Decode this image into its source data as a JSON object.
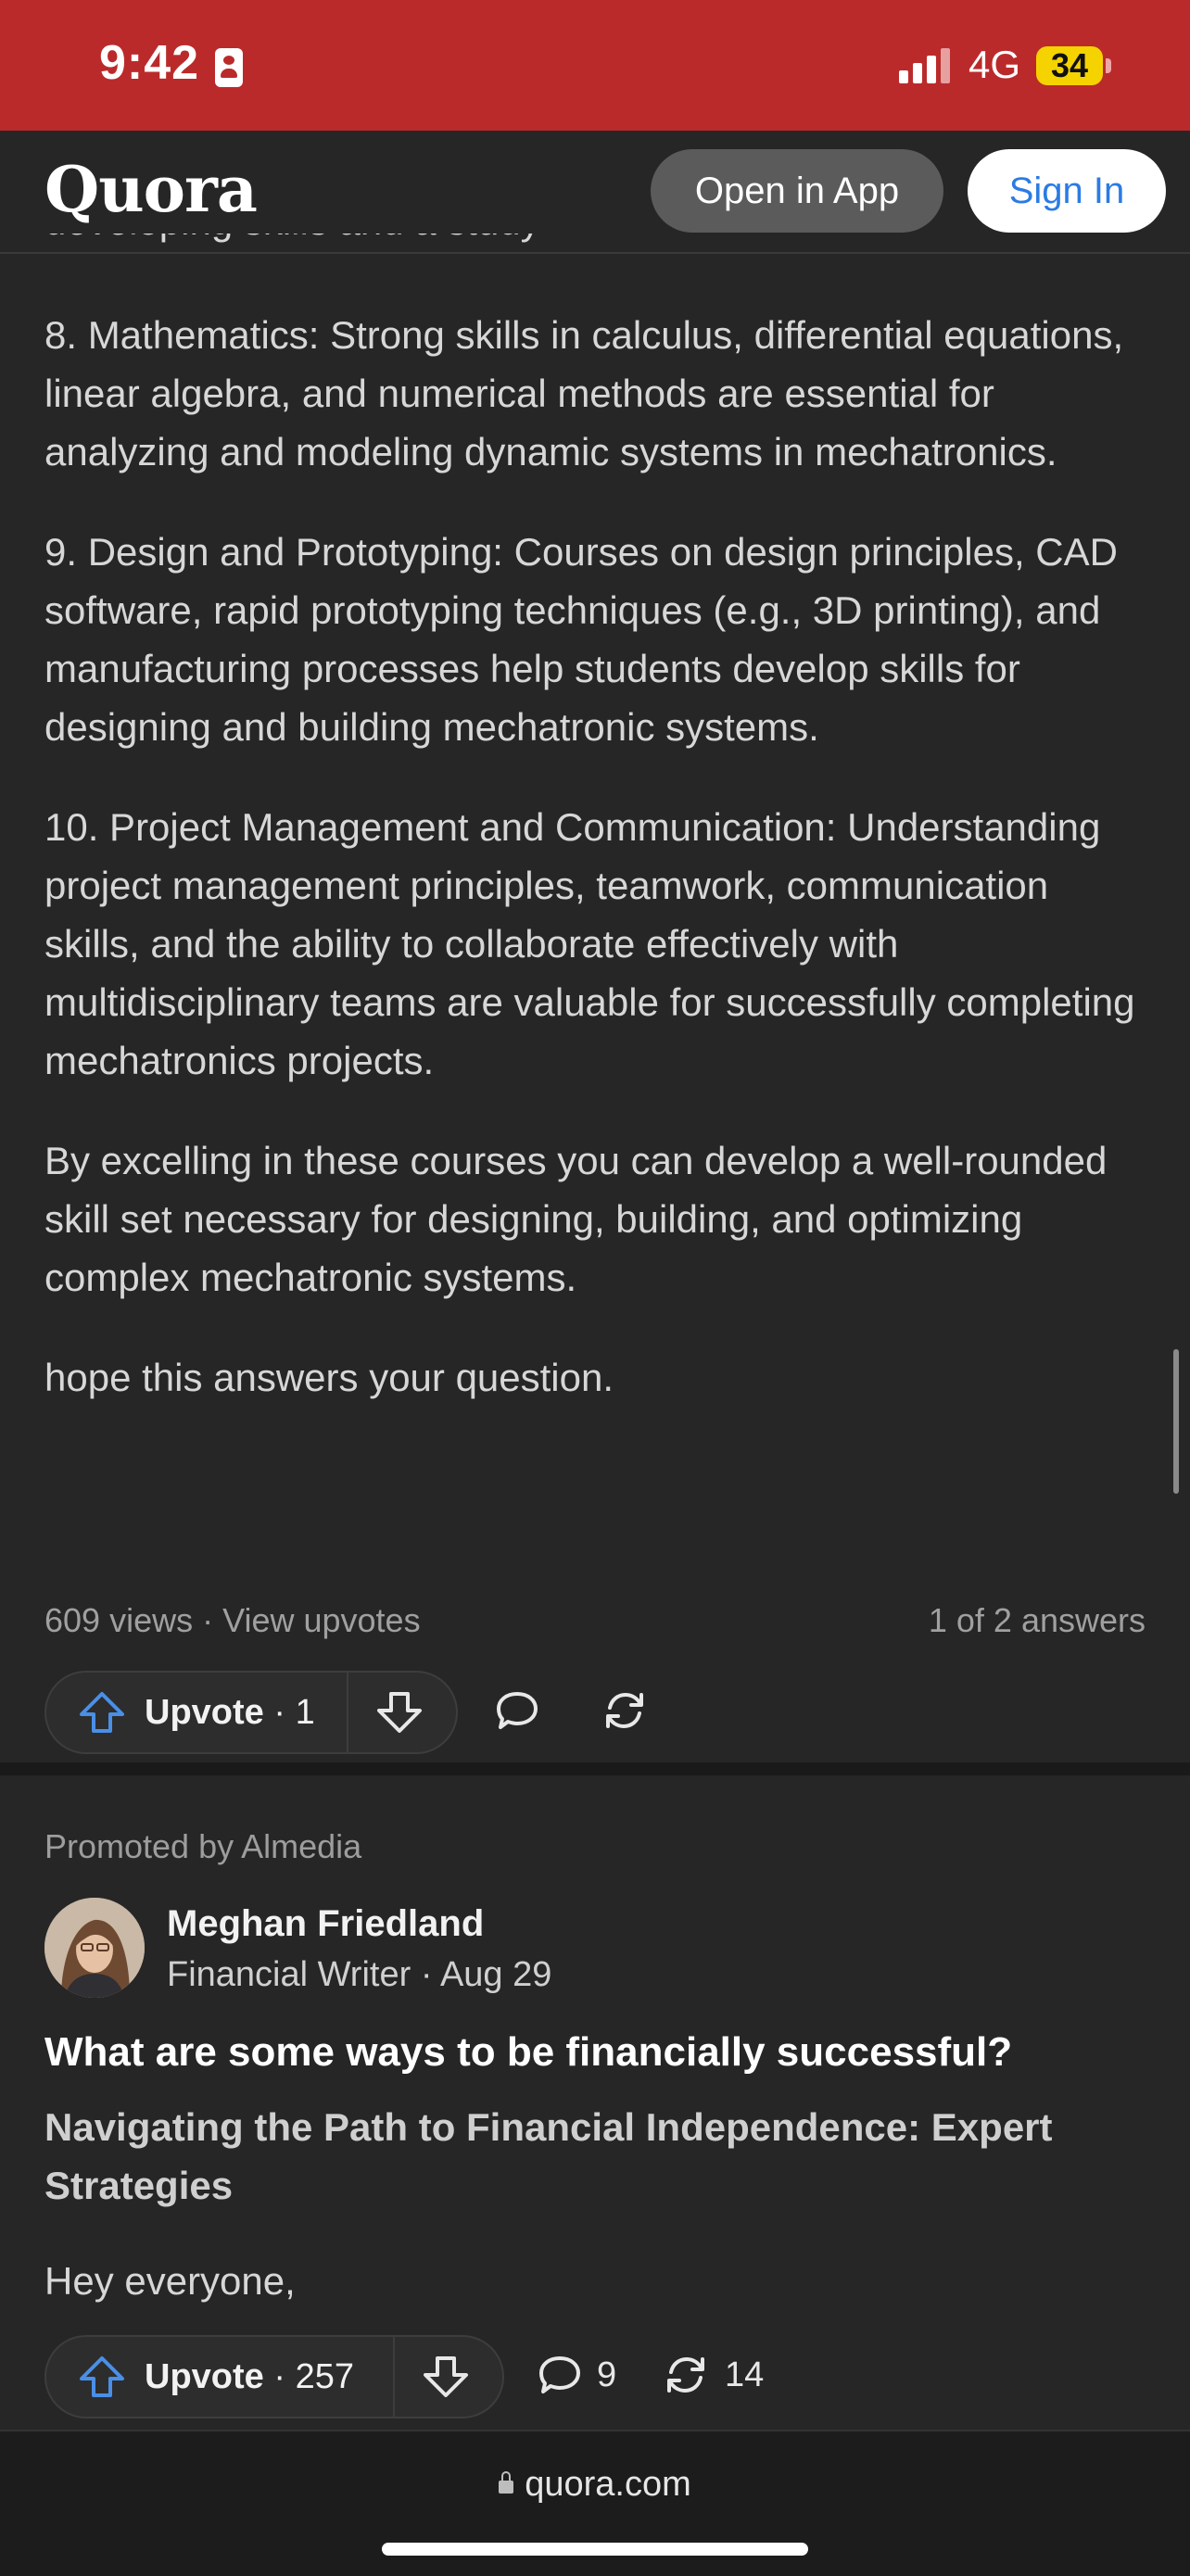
{
  "status_bar": {
    "time": "9:42",
    "network": "4G",
    "battery": "34"
  },
  "header": {
    "logo": "Quora",
    "open_in_app": "Open in App",
    "sign_in": "Sign In"
  },
  "answer": {
    "paragraphs": [
      "8. Mathematics: Strong skills in calculus, differential equations, linear algebra, and numerical methods are essential for analyzing and modeling dynamic systems in mechatronics.",
      "9. Design and Prototyping: Courses on design principles, CAD software, rapid prototyping techniques (e.g., 3D printing), and manufacturing processes help students develop skills for designing and building mechatronic systems.",
      "10. Project Management and Communication: Understanding project management principles, teamwork, communication skills, and the ability to collaborate effectively with multidisciplinary teams are valuable for successfully completing mechatronics projects.",
      "By excelling in these courses you can develop a well-rounded skill set necessary for designing, building, and optimizing complex mechatronic systems.",
      "hope this answers your question."
    ],
    "views": "609 views",
    "view_upvotes": "View upvotes",
    "answer_position": "1 of 2 answers",
    "upvote_label": "Upvote",
    "upvote_count": "1"
  },
  "promoted": {
    "label": "Promoted by Almedia",
    "author_name": "Meghan Friedland",
    "author_title": "Financial Writer",
    "date": "Aug 29",
    "question": "What are some ways to be financially successful?",
    "subtitle": "Navigating the Path to Financial Independence: Expert Strategies",
    "teaser": "Hey everyone,",
    "upvote_label": "Upvote",
    "upvote_count": "257",
    "comments": "9",
    "shares": "14"
  },
  "browser": {
    "url": "quora.com"
  },
  "icons": {
    "upvote": "upvote-arrow-icon",
    "downvote": "downvote-arrow-icon",
    "comment": "comment-bubble-icon",
    "share": "share-cycle-icon",
    "lock": "lock-icon"
  },
  "colors": {
    "status_bar_bg": "#bb2a2a",
    "page_bg": "#262626",
    "sign_in_text": "#2b7be4",
    "upvote_icon": "#4a8fe7",
    "battery": "#f5d300"
  }
}
